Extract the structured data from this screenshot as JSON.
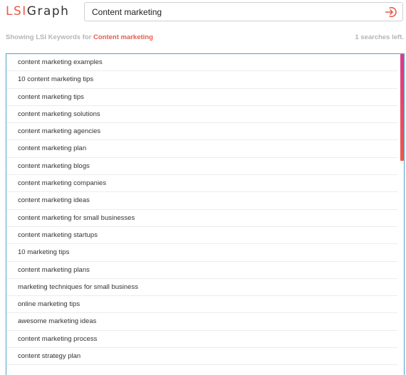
{
  "logo": {
    "part1": "LSI",
    "part2": "Graph"
  },
  "search": {
    "value": "Content marketing",
    "submit_icon": "login-arrow-icon"
  },
  "status": {
    "showing_prefix": "Showing LSI Keywords for",
    "keyword": "Content marketing",
    "searches_left": "1 searches left."
  },
  "colors": {
    "accent": "#ea5b4c",
    "border": "#4aa3c8",
    "scroll_top": "#d83a8c"
  },
  "keywords": [
    "content marketing examples",
    "10 content marketing tips",
    "content marketing tips",
    "content marketing solutions",
    "content marketing agencies",
    "content marketing plan",
    "content marketing blogs",
    "content marketing companies",
    "content marketing ideas",
    "content marketing for small businesses",
    "content marketing startups",
    "10 marketing tips",
    "content marketing plans",
    "marketing techniques for small business",
    "online marketing tips",
    "awesome marketing ideas",
    "content marketing process",
    "content strategy plan"
  ]
}
